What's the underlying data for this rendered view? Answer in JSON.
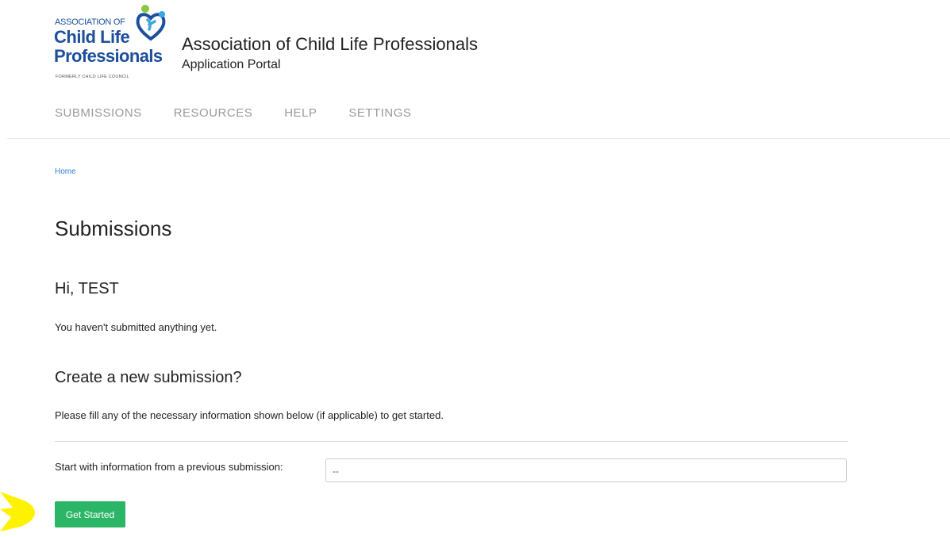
{
  "logo": {
    "line1": "ASSOCIATION OF",
    "line2": "Child Life",
    "line3": "Professionals",
    "line4": "FORMERLY CHILD LIFE COUNCIL"
  },
  "header": {
    "title": "Association of Child Life Professionals",
    "subtitle": "Application Portal"
  },
  "nav": {
    "items": [
      {
        "label": "SUBMISSIONS"
      },
      {
        "label": "RESOURCES"
      },
      {
        "label": "HELP"
      },
      {
        "label": "SETTINGS"
      }
    ]
  },
  "breadcrumb": {
    "home": "Home"
  },
  "main": {
    "title": "Submissions",
    "greeting": "Hi, TEST",
    "empty_message": "You haven't submitted anything yet.",
    "new_section_title": "Create a new submission?",
    "instructions": "Please fill any of the necessary information shown below (if applicable) to get started.",
    "previous_label": "Start with information from a previous submission:",
    "previous_value": "--",
    "button_label": "Get Started"
  },
  "colors": {
    "brand_blue": "#1c4f9c",
    "brand_green": "#8dc63f",
    "accent_button": "#2bb566",
    "link": "#2e7fd6",
    "nav_text": "#9a9a9a",
    "highlight": "#fff200"
  },
  "icons": [
    "family-heart-logo-icon",
    "highlight-arrow-icon"
  ]
}
